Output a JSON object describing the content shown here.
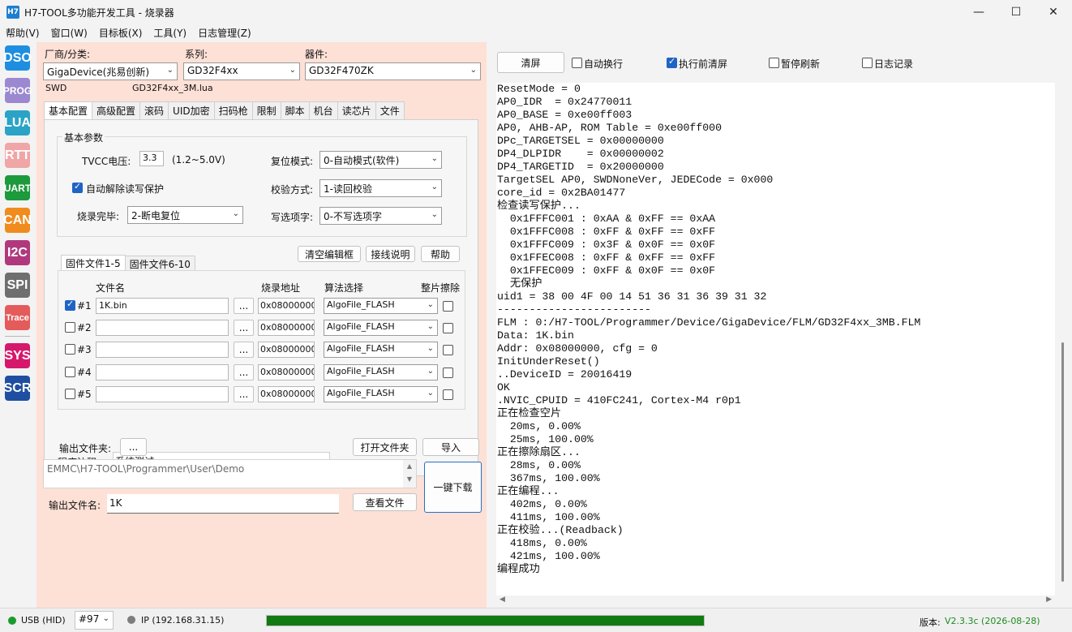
{
  "window": {
    "title": "H7-TOOL多功能开发工具 - 烧录器",
    "icon_text": "H7"
  },
  "menu": [
    "帮助(V)",
    "窗口(W)",
    "目标板(X)",
    "工具(Y)",
    "日志管理(Z)"
  ],
  "leftbar": [
    {
      "label": "DSO",
      "color": "#1e8fe0"
    },
    {
      "label": "PROG",
      "color": "#9b88d0"
    },
    {
      "label": "LUA",
      "color": "#2aa3c6"
    },
    {
      "label": "RTT",
      "color": "#f0a6a6"
    },
    {
      "label": "UART",
      "color": "#1c9a3c"
    },
    {
      "label": "CAN",
      "color": "#ef8c1d"
    },
    {
      "label": "I2C",
      "color": "#b0397d"
    },
    {
      "label": "SPI",
      "color": "#6f6f6f"
    },
    {
      "label": "Trace",
      "color": "#e45b5b"
    },
    {
      "label": "SYS",
      "color": "#d6186d"
    },
    {
      "label": "SCR",
      "color": "#1f4fa0"
    }
  ],
  "selectors": {
    "vendor_label": "厂商/分类:",
    "vendor_value": "GigaDevice(兆易创新)",
    "series_label": "系列:",
    "series_value": "GD32F4xx",
    "device_label": "器件:",
    "device_value": "GD32F470ZK",
    "interface": "SWD",
    "lua_file": "GD32F4xx_3M.lua"
  },
  "tabs": [
    "基本配置",
    "高级配置",
    "滚码",
    "UID加密",
    "扫码枪",
    "限制",
    "脚本",
    "机台",
    "读芯片",
    "文件"
  ],
  "basic": {
    "group_title": "基本参数",
    "tvcc_label": "TVCC电压:",
    "tvcc_value": "3.3",
    "tvcc_range": "(1.2~5.0V)",
    "auto_unprotect": "自动解除读写保护",
    "finish_label": "烧录完毕:",
    "finish_value": "2-断电复位",
    "reset_label": "复位模式:",
    "reset_value": "0-自动模式(软件)",
    "verify_label": "校验方式:",
    "verify_value": "1-读回校验",
    "option_label": "写选项字:",
    "option_value": "0-不写选项字"
  },
  "buttons": {
    "clear_edit": "清空编辑框",
    "wiring": "接线说明",
    "help": "帮助",
    "browse": "..."
  },
  "fw_tabs": [
    "固件文件1-5",
    "固件文件6-10"
  ],
  "fw_headers": {
    "name": "文件名",
    "addr": "烧录地址",
    "algo": "算法选择",
    "erase": "整片擦除"
  },
  "fw_rows": [
    {
      "idx": "#1",
      "checked": true,
      "file": "1K.bin",
      "addr": "0x08000000",
      "algo": "AlgoFile_FLASH"
    },
    {
      "idx": "#2",
      "checked": false,
      "file": "",
      "addr": "0x08000000",
      "algo": "AlgoFile_FLASH"
    },
    {
      "idx": "#3",
      "checked": false,
      "file": "",
      "addr": "0x08000000",
      "algo": "AlgoFile_FLASH"
    },
    {
      "idx": "#4",
      "checked": false,
      "file": "",
      "addr": "0x08000000",
      "algo": "AlgoFile_FLASH"
    },
    {
      "idx": "#5",
      "checked": false,
      "file": "",
      "addr": "0x08000000",
      "algo": "AlgoFile_FLASH"
    }
  ],
  "comment": {
    "label": "程序注释:",
    "value": "系统测试"
  },
  "output": {
    "folder_label": "输出文件夹:",
    "open_folder": "打开文件夹",
    "import": "导入",
    "path": "EMMC\\H7-TOOL\\Programmer\\User\\Demo",
    "one_click": "一键下载",
    "name_label": "输出文件名:",
    "name_value": "1K",
    "view_file": "查看文件"
  },
  "toolbar": {
    "clear": "清屏",
    "auto_wrap": "自动换行",
    "clear_before": "执行前清屏",
    "pause": "暂停刷新",
    "log": "日志记录"
  },
  "console": [
    "ResetMode = 0",
    "AP0_IDR  = 0x24770011",
    "AP0_BASE = 0xe00ff003",
    "AP0, AHB-AP, ROM Table = 0xe00ff000",
    "DPc_TARGETSEL = 0x00000000",
    "DP4_DLPIDR    = 0x00000002",
    "DP4_TARGETID  = 0x20000000",
    "TargetSEL AP0, SWDNoneVer, JEDECode = 0x000",
    "core_id = 0x2BA01477",
    "检查读写保护...",
    "  0x1FFFC001 : 0xAA & 0xFF == 0xAA",
    "  0x1FFFC008 : 0xFF & 0xFF == 0xFF",
    "  0x1FFFC009 : 0x3F & 0x0F == 0x0F",
    "  0x1FFEC008 : 0xFF & 0xFF == 0xFF",
    "  0x1FFEC009 : 0xFF & 0x0F == 0x0F",
    "  无保护",
    "uid1 = 38 00 4F 00 14 51 36 31 36 39 31 32",
    "------------------------",
    "FLM : 0:/H7-TOOL/Programmer/Device/GigaDevice/FLM/GD32F4xx_3MB.FLM",
    "Data: 1K.bin",
    "Addr: 0x08000000, cfg = 0",
    "InitUnderReset()",
    "..DeviceID = 20016419",
    "OK",
    ".NVIC_CPUID = 410FC241, Cortex-M4 r0p1",
    "正在检查空片",
    "  20ms, 0.00%",
    "  25ms, 100.00%",
    "正在擦除扇区...",
    "  28ms, 0.00%",
    "  367ms, 100.00%",
    "正在编程...",
    "  402ms, 0.00%",
    "  411ms, 100.00%",
    "正在校验...(Readback)",
    "  418ms, 0.00%",
    "  421ms, 100.00%",
    "编程成功"
  ],
  "status": {
    "usb": "USB (HID)",
    "port": "#97",
    "ip": "IP (192.168.31.15)",
    "progress": 1.0,
    "version_label": "版本:",
    "version": "V2.3.3c (2026-08-28)",
    "usb_color": "#1a9c2c",
    "progress_color": "#127a12"
  }
}
